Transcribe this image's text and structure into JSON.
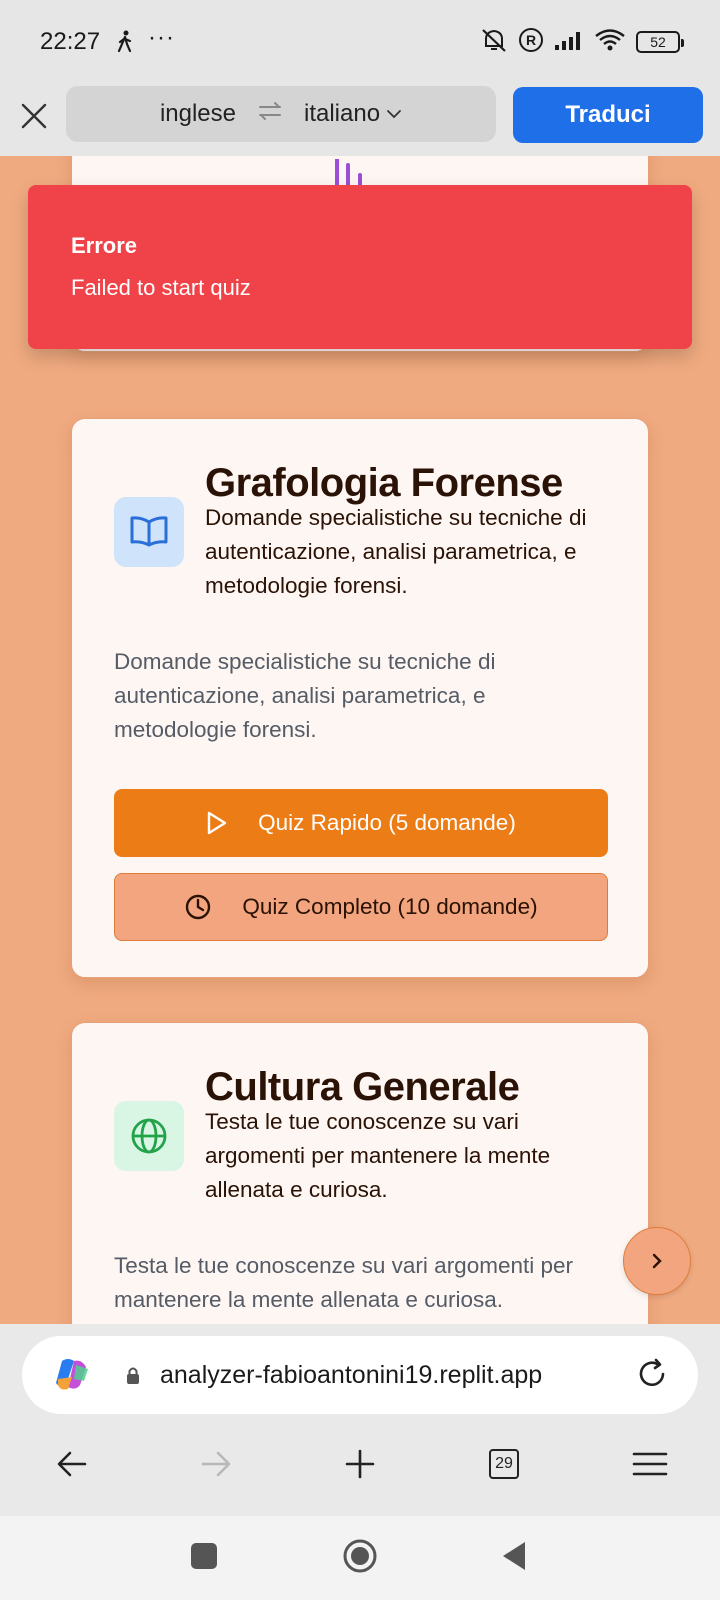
{
  "status_bar": {
    "time": "22:27",
    "dots": "···",
    "battery": "52",
    "icons": [
      "walking-icon",
      "mute-icon",
      "r-icon",
      "signal-icon",
      "wifi-icon",
      "battery-icon"
    ]
  },
  "translate_bar": {
    "source_lang": "inglese",
    "target_lang": "italiano",
    "translate_label": "Traduci"
  },
  "toast": {
    "title": "Errore",
    "message": "Failed to start quiz",
    "color": "#ef4349"
  },
  "cards": [
    {
      "title": "Grafologia Forense",
      "subtitle": "Domande specialistiche su tecniche di autenticazione, analisi parametrica, e metodologie forensi.",
      "description": "Domande specialistiche su tecniche di autenticazione, analisi parametrica, e metodologie forensi.",
      "icon": "book-icon",
      "quick_label": "Quiz Rapido (5 domande)",
      "full_label": "Quiz Completo (10 domande)"
    },
    {
      "title": "Cultura Generale",
      "subtitle": "Testa le tue conoscenze su vari argomenti per mantenere la mente allenata e curiosa.",
      "description": "Testa le tue conoscenze su vari argomenti per mantenere la mente allenata e curiosa.",
      "icon": "globe-icon"
    }
  ],
  "url_bar": {
    "url": "analyzer-fabioantonini19.replit.app"
  },
  "nav": {
    "tab_count": "29"
  },
  "colors": {
    "page_bg": "#f0aa80",
    "primary_orange": "#ec7d16",
    "translate_blue": "#1f6fe8"
  }
}
